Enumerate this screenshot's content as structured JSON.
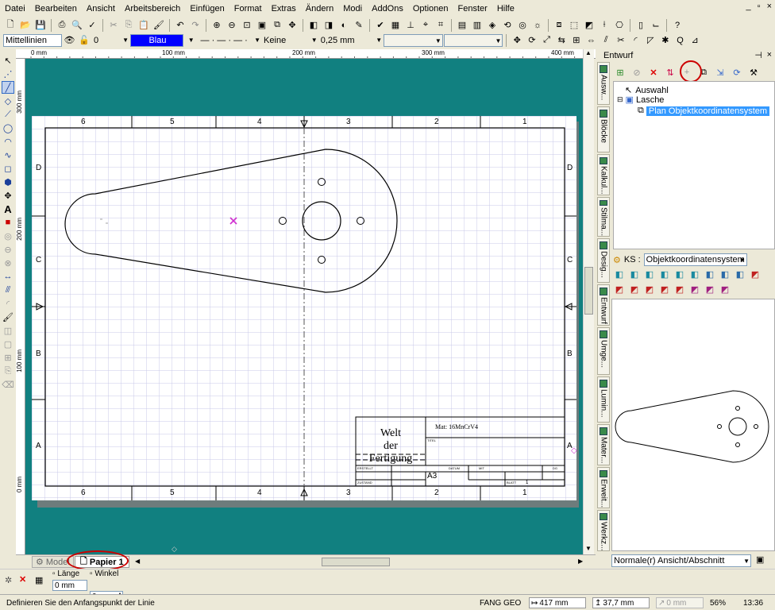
{
  "menu": [
    "Datei",
    "Bearbeiten",
    "Ansicht",
    "Arbeitsbereich",
    "Einfügen",
    "Format",
    "Extras",
    "Ändern",
    "Modi",
    "AddOns",
    "Optionen",
    "Fenster",
    "Hilfe"
  ],
  "window_controls": [
    "_",
    "▫",
    "×"
  ],
  "props": {
    "layer": "Mittellinien",
    "layer_num": "0",
    "color": "Blau",
    "fill": "Keine",
    "width": "0,25 mm",
    "colors": {
      "color_box": "#0000ff",
      "canvas_bg": "#118080",
      "selection": "#3399ff",
      "highlight_circle": "#cc0000"
    }
  },
  "ruler": {
    "h": [
      "0 mm",
      "100 mm",
      "200 mm",
      "300 mm",
      "400 mm"
    ],
    "v": [
      "300 mm",
      "200 mm",
      "100 mm",
      "0 mm"
    ]
  },
  "drawing": {
    "cols_top": [
      "6",
      "5",
      "4",
      "3",
      "2",
      "1"
    ],
    "cols_bottom": [
      "6",
      "5",
      "4",
      "3",
      "2",
      "1"
    ],
    "rows_left": [
      "D",
      "C",
      "B",
      "A"
    ],
    "rows_right": [
      "D",
      "C",
      "B",
      "A"
    ],
    "title_main": [
      "Welt",
      "der",
      "Fertigung"
    ],
    "material": "Mat: 16MnCrV4",
    "field_titel": "TITEL",
    "field_erstellt": "ERSTELLT",
    "field_datum": "DATUM",
    "field_mit": "MIT",
    "field_dg": "DG",
    "format": "A3",
    "field_zustand": "ZUSTAND",
    "field_blatt": "BLATT",
    "blatt_val": "1"
  },
  "sheet_tabs": {
    "model": "Model",
    "paper": "Papier 1"
  },
  "panel": {
    "title": "Entwurf",
    "tree": [
      "Auswahl",
      "Lasche",
      "Plan Objektkoordinatensystem"
    ],
    "ks_label": "KS :",
    "ks_value": "Objektkoordinatensystem",
    "view_value": "Normale(r) Ansicht/Abschnitt",
    "side_tabs": [
      "Ausw...",
      "Blöcke",
      "Kalkul...",
      "Stilma...",
      "Desig...",
      "Entwurf",
      "Umge...",
      "Lumin...",
      "Mater...",
      "Erweit...",
      "Werkz..."
    ]
  },
  "input": {
    "laenge_label": "Länge",
    "laenge_val": "0 mm",
    "winkel_label": "Winkel",
    "winkel_val": "0"
  },
  "status": {
    "message": "Definieren Sie den Anfangspunkt der Linie",
    "fang": "FANG",
    "geo": "GEO",
    "x": "417 mm",
    "y": "37,7 mm",
    "z": "0 mm",
    "zoom": "56%",
    "time": "13:36"
  }
}
